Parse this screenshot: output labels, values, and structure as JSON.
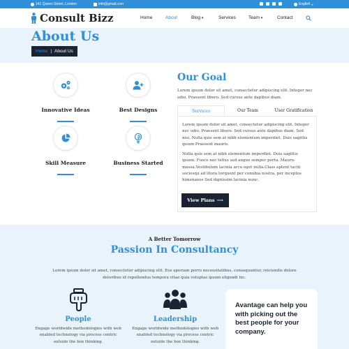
{
  "topbar": {
    "address": "141 Queen Street, London",
    "email": "info@gmail.com",
    "language": "English"
  },
  "header": {
    "logo": "Consult Bizz",
    "nav": [
      "Home",
      "About",
      "Blog",
      "Services",
      "Team",
      "Contact"
    ],
    "active": "About"
  },
  "banner": {
    "title": "About Us",
    "crumb_home": "Home",
    "crumb_sep": "|",
    "crumb_current": "About Us"
  },
  "features": [
    {
      "label": "Innovative Ideas",
      "icon": "gears-icon"
    },
    {
      "label": "Best Designs",
      "icon": "user-plus-icon"
    },
    {
      "label": "Skill Measure",
      "icon": "pie-chart-icon"
    },
    {
      "label": "Business Started",
      "icon": "lightbulb-icon"
    }
  ],
  "goal": {
    "title": "Our Goal",
    "text": "Lorem ipsum dolor sit amet, consectetur adipiscing elit. Integer nec odio. Praesent libero. Sed cursus ante dapibus diam.",
    "tabs": [
      "Services",
      "Our Team",
      "User Gratification"
    ],
    "active_tab": "Services",
    "panel_p1": "Lorem ipsum dolor sit amet, consectetur adipiscing elit. Integer nec odio. Praesent libero. Sed cursus ante dapibus diam. Sed nisi. Nulla quis sem at nibh elementum imperdiet. Duis sagittis ipsum Praesent mauris.",
    "panel_p2": "Nulla quis sem at nibh elementum imperdiet. Duis sagittis ipsum. Fusce nec tellus sed augue semper porta. Mauris massa.Vestibulum lacinia arcu eget nulla.Class aptent taciti sociosqu ad litora torquent per conubia nostra, per inceptos himenaeos Sed dignissim lacinia nunc.",
    "button": "View Plans",
    "button_arrow": "⟶"
  },
  "passion": {
    "kicker": "A Better Tomorrow",
    "title": "Passion In Consultancy",
    "text": "Lorem ipsum dolor sit amet, consectetur adipiscing elit. Eos aperiam porro necessitatibus, consequuntur, reiciendis dolore doloribus id repellendus tempora vitae quia voluptas ipsum eligendi hic.",
    "items": [
      {
        "title": "People",
        "desc": "Engage worldwide methodologies with web enabled technology via process centric outside the box thinking.",
        "icon": "hand-pointer-icon"
      },
      {
        "title": "Leadership",
        "desc": "Engage worldwide methodologies with web enabled technology via process centric outside the box thinking.",
        "icon": "users-icon"
      }
    ],
    "card_text": "Avantage can help you with picking out the best people for your company."
  },
  "colors": {
    "accent": "#2f8fd8",
    "dark": "#1b2333",
    "light_bg": "#e8f3fb"
  }
}
